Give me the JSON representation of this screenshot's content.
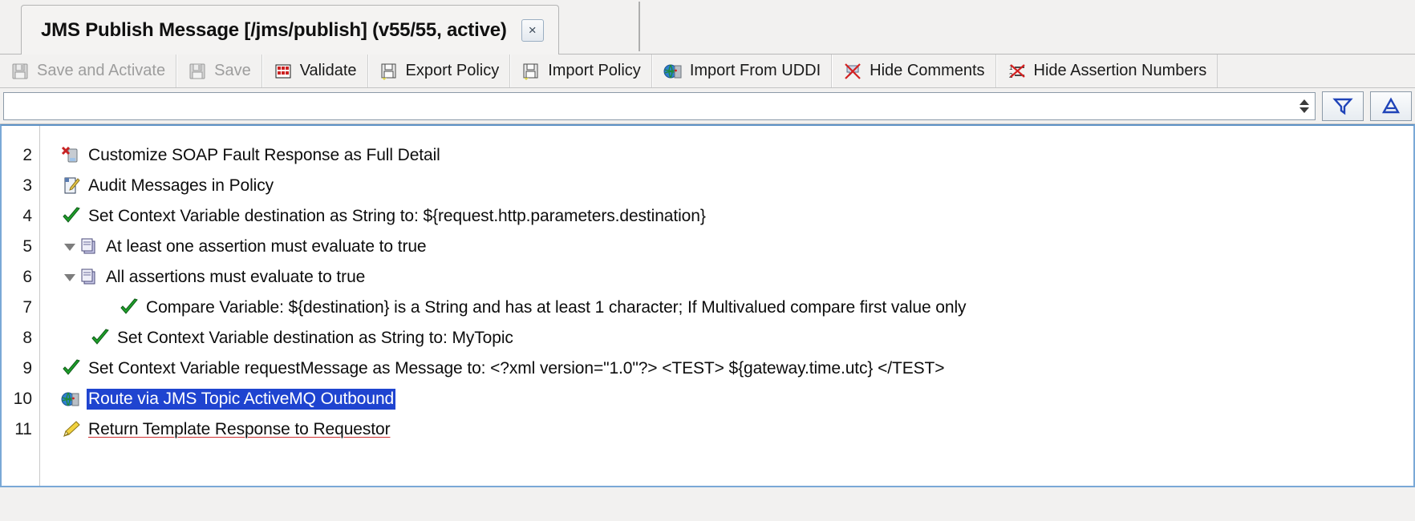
{
  "window": {
    "tab": {
      "title": "JMS Publish Message [/jms/publish] (v55/55, active)",
      "close_label": "×"
    }
  },
  "toolbar": {
    "buttons": [
      {
        "label": "Save and Activate",
        "icon": "save-icon",
        "disabled": true
      },
      {
        "label": "Save",
        "icon": "save-icon",
        "disabled": true
      },
      {
        "label": "Validate",
        "icon": "validate-icon",
        "disabled": false
      },
      {
        "label": "Export Policy",
        "icon": "export-policy-icon",
        "disabled": false
      },
      {
        "label": "Import Policy",
        "icon": "import-policy-icon",
        "disabled": false
      },
      {
        "label": "Import From UDDI",
        "icon": "uddi-globe-icon",
        "disabled": false
      },
      {
        "label": "Hide Comments",
        "icon": "hide-comments-icon",
        "disabled": false
      },
      {
        "label": "Hide Assertion Numbers",
        "icon": "hide-assertion-numbers-icon",
        "disabled": false
      }
    ]
  },
  "filterbar": {
    "input_value": "",
    "input_placeholder": "",
    "spinner_icon": "spinner-updown-icon",
    "filter_icon": "funnel-filter-icon",
    "assertion_icon": "assertion-filter-icon"
  },
  "policy": {
    "colors": {
      "selection_background": "#1f44d0",
      "selection_text": "#ffffff",
      "comment_underline": "#d03030",
      "tree_border": "#7aa8d6"
    },
    "rows": [
      {
        "number": "2",
        "indent": 1,
        "twisty": "none",
        "icon": "soap-fault-icon",
        "label": "Customize SOAP Fault Response as Full Detail",
        "selected": false,
        "underlined": false
      },
      {
        "number": "3",
        "indent": 1,
        "twisty": "none",
        "icon": "audit-messages-icon",
        "label": "Audit Messages in Policy",
        "selected": false,
        "underlined": false
      },
      {
        "number": "4",
        "indent": 1,
        "twisty": "none",
        "icon": "green-check-icon",
        "label": "Set Context Variable destination as String to: ${request.http.parameters.destination}",
        "selected": false,
        "underlined": false
      },
      {
        "number": "5",
        "indent": 0,
        "twisty": "expanded",
        "icon": "folder-oneormore-icon",
        "label": "At least one assertion must evaluate to true",
        "selected": false,
        "underlined": false
      },
      {
        "number": "6",
        "indent": 1,
        "twisty": "expanded",
        "icon": "folder-all-icon",
        "label": "All assertions must evaluate to true",
        "selected": false,
        "underlined": false
      },
      {
        "number": "7",
        "indent": 3,
        "twisty": "none",
        "icon": "green-check-icon",
        "label": "Compare Variable: ${destination} is a String and has at least 1 character; If Multivalued compare first value only",
        "selected": false,
        "underlined": false
      },
      {
        "number": "8",
        "indent": 2,
        "twisty": "none",
        "icon": "green-check-icon",
        "label": "Set Context Variable destination as String to: MyTopic",
        "selected": false,
        "underlined": false
      },
      {
        "number": "9",
        "indent": 1,
        "twisty": "none",
        "icon": "green-check-icon",
        "label": "Set Context Variable requestMessage as Message to: <?xml version=\"1.0\"?>  <TEST>  ${gateway.time.utc}  </TEST>",
        "selected": false,
        "underlined": false
      },
      {
        "number": "10",
        "indent": 1,
        "twisty": "none",
        "icon": "route-jms-icon",
        "label": "Route via JMS Topic ActiveMQ Outbound",
        "selected": true,
        "underlined": false
      },
      {
        "number": "11",
        "indent": 1,
        "twisty": "none",
        "icon": "template-response-icon",
        "label": "Return Template Response to Requestor",
        "selected": false,
        "underlined": true
      }
    ]
  }
}
